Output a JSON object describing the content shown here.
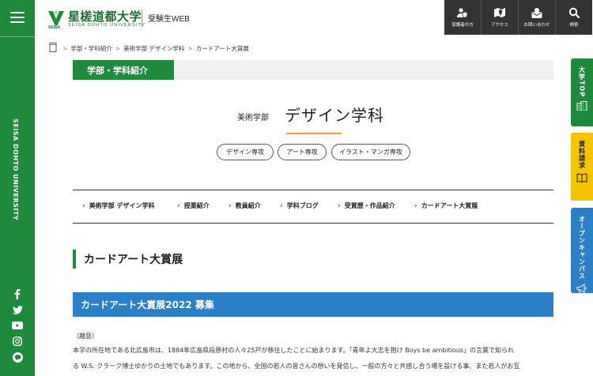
{
  "header": {
    "logo_title": "星槎道都大学",
    "logo_subtitle": "SEISA DOHTO UNIVERSITY",
    "logo_mark_text": "SEISA",
    "exam_link": "受験生WEB",
    "nav": [
      {
        "label": "保護者の方",
        "icon": "parent-icon"
      },
      {
        "label": "アクセス",
        "icon": "map-icon"
      },
      {
        "label": "お問い合わせ",
        "icon": "mail-icon"
      },
      {
        "label": "検索",
        "icon": "search-icon"
      }
    ]
  },
  "sidebar": {
    "vertical_text": "SEISA DOHTO UNIVERSITY",
    "social": [
      "facebook-icon",
      "twitter-icon",
      "youtube-icon",
      "instagram-icon",
      "line-icon"
    ]
  },
  "breadcrumb": [
    "学部・学科紹介",
    "美術学部 デザイン学科",
    "カードアート大賞展"
  ],
  "section_tag": "学部・学科紹介",
  "title": {
    "faculty": "美術学部",
    "department": "デザイン学科"
  },
  "tags": [
    "デザイン専攻",
    "アート専攻",
    "イラスト・マンガ専攻"
  ],
  "subnav": [
    "美術学部 デザイン学科",
    "授業紹介",
    "教員紹介",
    "学科ブログ",
    "受賞歴・作品紹介",
    "カードアート大賞展"
  ],
  "page_heading": "カードアート大賞展",
  "banner": "カードアート大賞展2022 募集",
  "body": {
    "purpose": "（趣意）",
    "lines": [
      "本学の所在地である北広島市は、1884年広島県段原村の人々25戸が移住したことに始まります。「青年よ大志を抱け Boys be ambitious」の言葉で知られ",
      "る W.S. クラーク博士ゆかりの土地でもあります。この地から、全国の若人の皆さんの想いを発信し、一般の方々と共感し合う場を設ける事、また若人がお互"
    ]
  },
  "float_buttons": [
    {
      "label": "大学TOP",
      "icon": "building-icon",
      "bg": "#1f8a3b",
      "fg": "#ffffff"
    },
    {
      "label": "資料請求",
      "icon": "book-icon",
      "bg": "#f5c400",
      "fg": "#222222"
    },
    {
      "label": "オープンキャンパス",
      "icon": "megaphone-icon",
      "bg": "#2a7fc6",
      "fg": "#ffffff"
    }
  ],
  "colors": {
    "brand_green": "#1f8a3b",
    "accent_blue": "#2a7fc6",
    "accent_orange": "#f0a020",
    "nav_dark": "#333333"
  }
}
